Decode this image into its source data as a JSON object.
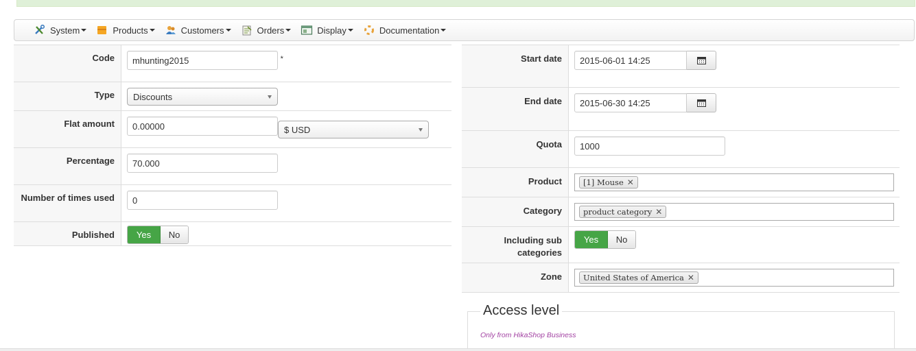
{
  "menu": {
    "items": [
      {
        "label": "System",
        "icon": "tools-icon"
      },
      {
        "label": "Products",
        "icon": "box-icon"
      },
      {
        "label": "Customers",
        "icon": "users-icon"
      },
      {
        "label": "Orders",
        "icon": "orders-icon"
      },
      {
        "label": "Display",
        "icon": "display-icon"
      },
      {
        "label": "Documentation",
        "icon": "lifebuoy-icon"
      }
    ]
  },
  "left": {
    "code": {
      "label": "Code",
      "value": "mhunting2015",
      "required": "*"
    },
    "type": {
      "label": "Type",
      "value": "Discounts"
    },
    "flat_amount": {
      "label": "Flat amount",
      "value": "0.00000",
      "currency": "$ USD"
    },
    "percentage": {
      "label": "Percentage",
      "value": "70.000"
    },
    "times_used": {
      "label": "Number of times used",
      "value": "0"
    },
    "published": {
      "label": "Published",
      "yes": "Yes",
      "no": "No",
      "selected": "Yes"
    }
  },
  "right": {
    "start_date": {
      "label": "Start date",
      "value": "2015-06-01 14:25"
    },
    "end_date": {
      "label": "End date",
      "value": "2015-06-30 14:25"
    },
    "quota": {
      "label": "Quota",
      "value": "1000"
    },
    "product": {
      "label": "Product",
      "tag": "[1] Mouse"
    },
    "category": {
      "label": "Category",
      "tag": "product category"
    },
    "sub_categories": {
      "label": "Including sub categories",
      "yes": "Yes",
      "no": "No",
      "selected": "Yes"
    },
    "zone": {
      "label": "Zone",
      "tag": "United States of America"
    }
  },
  "access": {
    "title": "Access level",
    "note": "Only from HikaShop Business"
  },
  "colors": {
    "accent_green": "#46a546",
    "note_purple": "#a241a2"
  }
}
